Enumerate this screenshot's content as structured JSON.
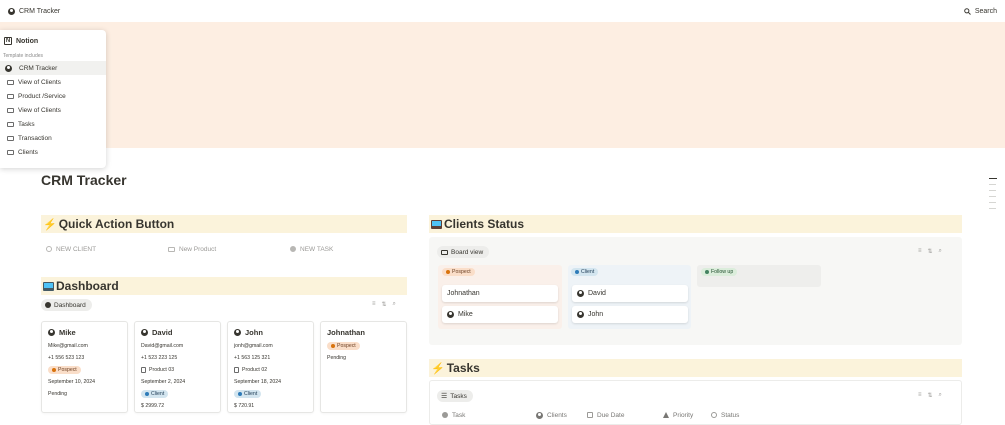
{
  "topbar": {
    "title": "CRM Tracker",
    "search_label": "Search"
  },
  "sidebar": {
    "brand": "Notion",
    "subtitle": "Template includes",
    "items": [
      {
        "label": "CRM Tracker",
        "active": true
      },
      {
        "label": "View of Clients"
      },
      {
        "label": "Product /Service"
      },
      {
        "label": "View of Clients"
      },
      {
        "label": "Tasks"
      },
      {
        "label": "Transaction"
      },
      {
        "label": "Clients"
      }
    ]
  },
  "page": {
    "title": "CRM Tracker"
  },
  "quick_actions": {
    "heading": "Quick Action Button",
    "buttons": [
      {
        "label": "NEW CLIENT"
      },
      {
        "label": "New Product"
      },
      {
        "label": "NEW TASK"
      }
    ]
  },
  "dashboard": {
    "heading": "Dashboard",
    "view_label": "Dashboard",
    "cards": [
      {
        "name": "Mike",
        "email": "Mike@gmail.com",
        "phone": "+1 556 523 123",
        "status": "Pospect",
        "date": "September 10, 2024",
        "state": "Pending"
      },
      {
        "name": "David",
        "email": "David@gmail.com",
        "phone": "+1 523 223 125",
        "product": "Product 03",
        "date": "September 2, 2024",
        "status": "Client",
        "amount": "$ 2999.72"
      },
      {
        "name": "John",
        "email": "jonh@gmail.com",
        "phone": "+1 563 125 321",
        "product": "Product 02",
        "date": "September 18, 2024",
        "status": "Client",
        "amount": "$ 720.91"
      },
      {
        "name": "Johnathan",
        "status": "Pospect",
        "state": "Pending"
      }
    ]
  },
  "clients_status": {
    "heading": "Clients Status",
    "view_label": "Board view",
    "columns": [
      {
        "label": "Pospect",
        "cards": [
          "Johnathan",
          "Mike"
        ]
      },
      {
        "label": "Client",
        "cards": [
          "David",
          "John"
        ]
      },
      {
        "label": "Follow up",
        "cards": []
      }
    ]
  },
  "tasks": {
    "heading": "Tasks",
    "view_label": "Tasks",
    "columns": [
      "Task",
      "Clients",
      "Due Date",
      "Priority",
      "Status"
    ]
  },
  "colors": {
    "banner": "#fdeee2",
    "section_bg": "#fbf3db",
    "prospect": "#d9730d",
    "client": "#2e7bb8",
    "follow_up": "#448361"
  }
}
